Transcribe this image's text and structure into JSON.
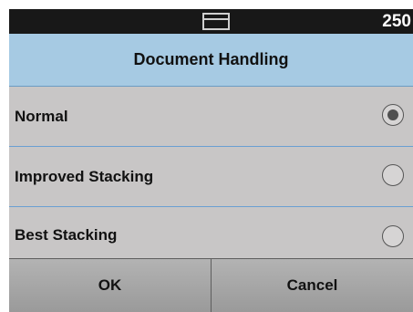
{
  "status_bar": {
    "icon": "output-tray-icon",
    "counter": "250"
  },
  "title": "Document Handling",
  "options": [
    {
      "label": "Normal",
      "selected": true
    },
    {
      "label": "Improved Stacking",
      "selected": false
    },
    {
      "label": "Best Stacking",
      "selected": false
    }
  ],
  "buttons": {
    "ok": "OK",
    "cancel": "Cancel"
  },
  "colors": {
    "title_bar": "#a6cae3",
    "background": "#c8c6c6",
    "status_bar": "#181818"
  }
}
